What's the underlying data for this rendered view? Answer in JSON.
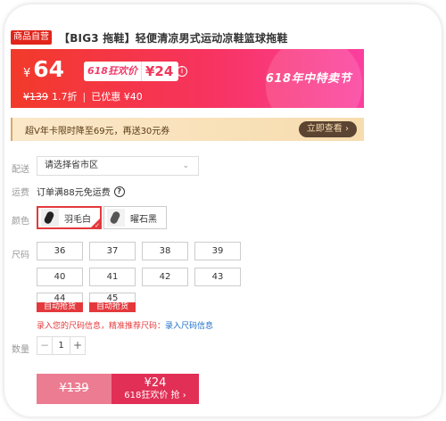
{
  "product": {
    "badge": "商品自营",
    "title": "【BIG3 拖鞋】轻便清凉男式运动凉鞋篮球拖鞋"
  },
  "price": {
    "currency": "¥",
    "value": "64",
    "promo_tag": "618狂欢价",
    "promo_price": "¥24",
    "info_icon": "ⓘ",
    "original": "¥139",
    "discount": "1.7折",
    "separator": "|",
    "saved": "已优惠 ¥40",
    "festival": "618年中特卖节"
  },
  "coupon": {
    "text": "超V年卡限时降至69元，再送30元券",
    "button": "立即查看 ›"
  },
  "shipping": {
    "label": "配送",
    "select_value": "请选择省市区",
    "chevron": "⌄"
  },
  "fee": {
    "label": "运费",
    "text": "订单满88元免运费",
    "icon": "?"
  },
  "color": {
    "label": "颜色",
    "options": [
      "羽毛白",
      "曜石黑"
    ],
    "selected": "羽毛白"
  },
  "size": {
    "label": "尺码",
    "options": [
      "36",
      "37",
      "38",
      "39",
      "40",
      "41",
      "42",
      "43",
      "44",
      "45"
    ],
    "auto_tag": "自动抢货",
    "tip": "录入您的尺码信息，精准推荐尺码：",
    "tip_link": "录入尺码信息"
  },
  "quantity": {
    "label": "数量",
    "minus": "−",
    "value": "1",
    "plus": "+"
  },
  "buttons": {
    "original_price": "¥139",
    "promo_price": "¥24",
    "promo_label": "618狂欢价 抢 ›"
  },
  "colors": {
    "accent_red": "#e4393c",
    "banner_start": "#f23a2a",
    "banner_end": "#fb3f9f",
    "link_blue": "#1e6fc9"
  }
}
